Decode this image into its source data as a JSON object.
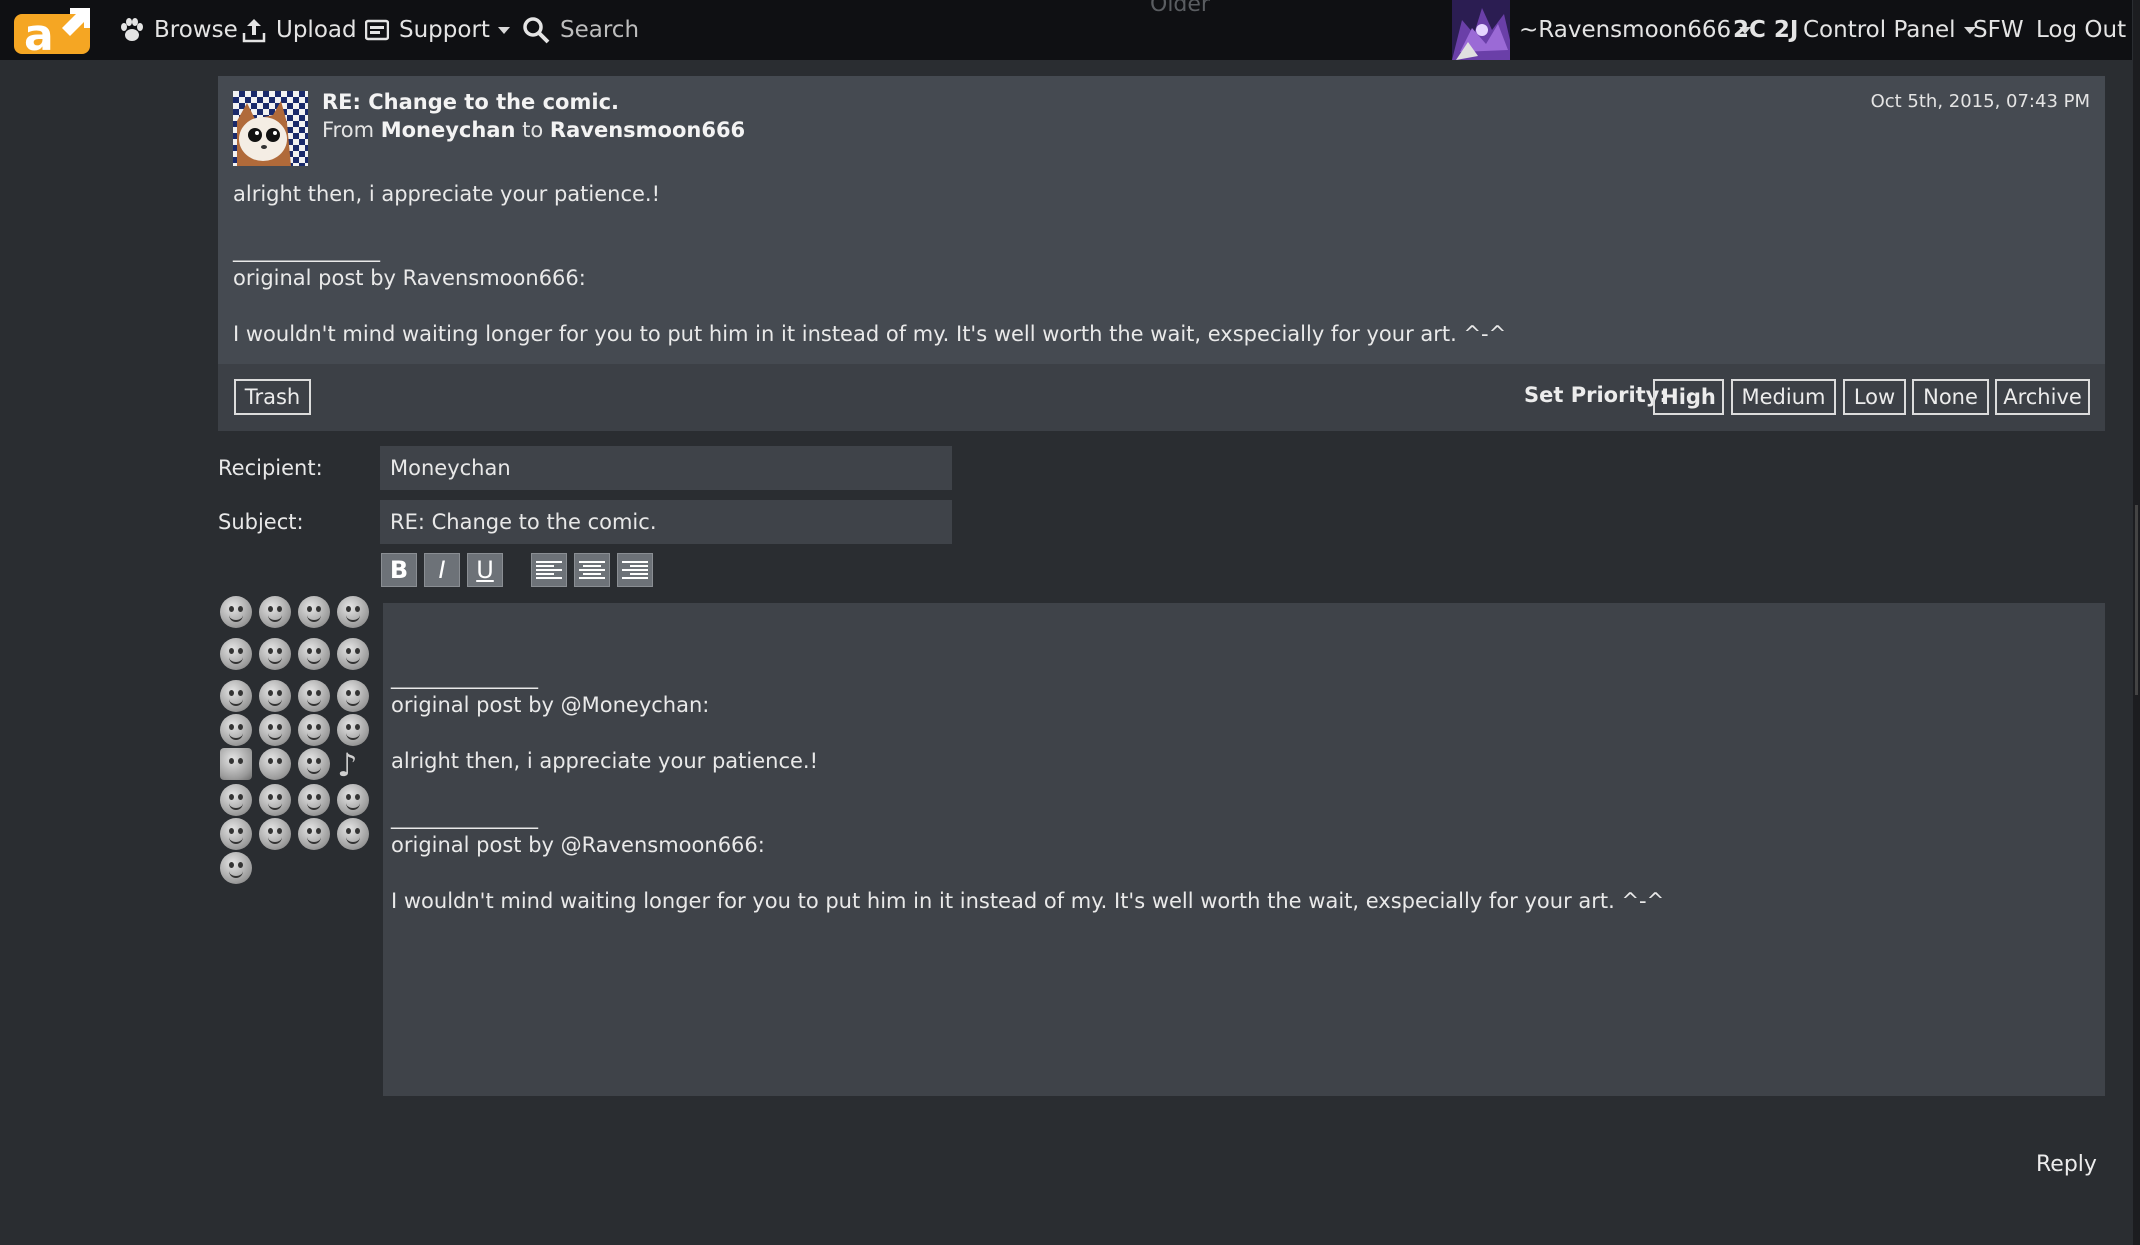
{
  "nav": {
    "browse": "Browse",
    "upload": "Upload",
    "support": "Support",
    "search_placeholder": "Search",
    "older": "Older",
    "username": "~Ravensmoon666",
    "counts": "2C 2J",
    "control_panel": "Control Panel",
    "sfw": "SFW",
    "logout": "Log Out"
  },
  "message": {
    "subject": "RE: Change to the comic.",
    "from_word": "From",
    "from": "Moneychan",
    "to_word": "to",
    "to": "Ravensmoon666",
    "date": "Oct 5th, 2015, 07:43 PM",
    "body": "alright then, i appreciate your patience.!",
    "separator": "______________",
    "quote_header": "original post by Ravensmoon666:",
    "quote": "I wouldn't mind waiting longer for you to put him in it instead of my. It's well worth the wait, exspecially for your art. ^-^"
  },
  "actions": {
    "trash": "Trash",
    "set_priority": "Set Priority:",
    "high": "High",
    "medium": "Medium",
    "low": "Low",
    "none": "None",
    "archive": "Archive"
  },
  "form": {
    "recipient_label": "Recipient:",
    "recipient_value": "Moneychan",
    "subject_label": "Subject:",
    "subject_value": "RE: Change to the comic.",
    "bold": "B",
    "italic": "I",
    "underline": "U"
  },
  "editor": {
    "separator1": "______________",
    "quote1_header": "original post by @Moneychan:",
    "quote1": "alright then, i appreciate your patience.!",
    "separator2": "______________",
    "quote2_header": "original post by @Ravensmoon666:",
    "quote2": "I wouldn't mind waiting longer for you to put him in it instead of my. It's well worth the wait, exspecially for your art. ^-^"
  },
  "reply": "Reply",
  "colors": {
    "page_bg": "#2a2d31",
    "nav_bg": "#0f1013",
    "card_bg": "#454a51",
    "field_bg": "#3f4349",
    "logo_orange": "#f5a623"
  }
}
